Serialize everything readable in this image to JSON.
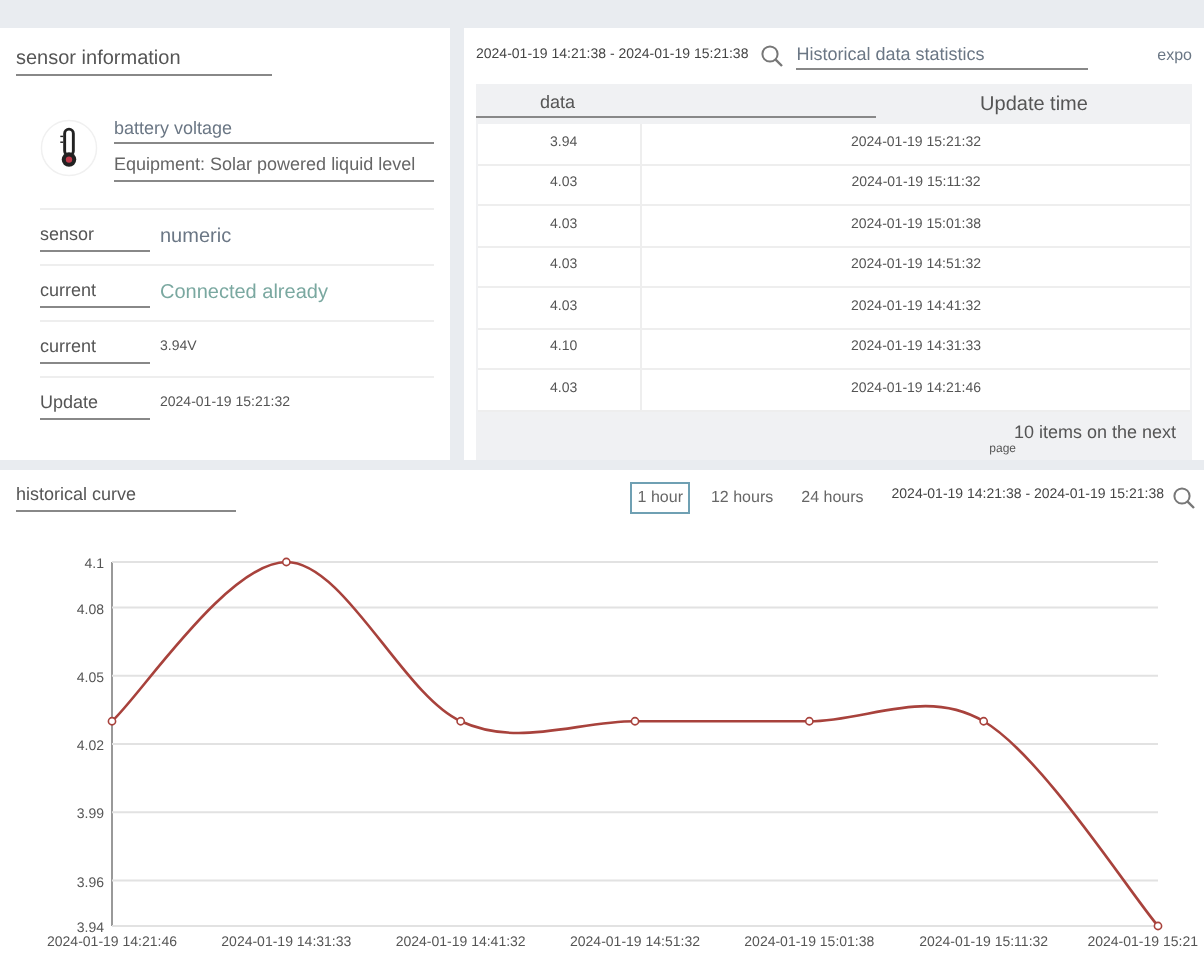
{
  "sensor_info": {
    "title": "sensor information",
    "name": "battery voltage",
    "equipment": "Equipment: Solar powered liquid level",
    "fields": [
      {
        "kind": "plain",
        "label": "sensor",
        "value": "numeric"
      },
      {
        "kind": "status",
        "label": "current",
        "value": "Connected already"
      },
      {
        "kind": "small",
        "label": "current",
        "value": "3.94V"
      },
      {
        "kind": "small",
        "label": "Update",
        "value": "2024-01-19 15:21:32"
      }
    ]
  },
  "history_table": {
    "date_range": "2024-01-19 14:21:38 - 2024-01-19 15:21:38",
    "tab": "Historical data statistics",
    "export": "expo",
    "columns": [
      "data",
      "Update time"
    ],
    "rows": [
      [
        "3.94",
        "2024-01-19 15:21:32"
      ],
      [
        "4.03",
        "2024-01-19 15:11:32"
      ],
      [
        "4.03",
        "2024-01-19 15:01:38"
      ],
      [
        "4.03",
        "2024-01-19 14:51:32"
      ],
      [
        "4.03",
        "2024-01-19 14:41:32"
      ],
      [
        "4.10",
        "2024-01-19 14:31:33"
      ],
      [
        "4.03",
        "2024-01-19 14:21:46"
      ]
    ],
    "pagination": "10 items on the next",
    "pagination_2": "page"
  },
  "curve": {
    "title": "historical curve",
    "ranges": [
      {
        "label": "1 hour",
        "selected": true
      },
      {
        "label": "12 hours",
        "selected": false
      },
      {
        "label": "24 hours",
        "selected": false
      }
    ],
    "date_range": "2024-01-19 14:21:38 - 2024-01-19 15:21:38",
    "chart_data": {
      "type": "line",
      "categories": [
        "2024-01-19 14:21:46",
        "2024-01-19 14:31:33",
        "2024-01-19 14:41:32",
        "2024-01-19 14:51:32",
        "2024-01-19 15:01:38",
        "2024-01-19 15:11:32",
        "2024-01-19 15:21"
      ],
      "series": [
        {
          "color": "#a8423c",
          "marker": true,
          "values": [
            4.03,
            4.1,
            4.03,
            4.03,
            4.03,
            4.03,
            3.94
          ]
        }
      ],
      "grid": true,
      "ylim": [
        3.94,
        4.1
      ],
      "yticks": [
        3.94,
        3.96,
        3.99,
        4.02,
        4.05,
        4.08,
        4.1
      ]
    }
  }
}
